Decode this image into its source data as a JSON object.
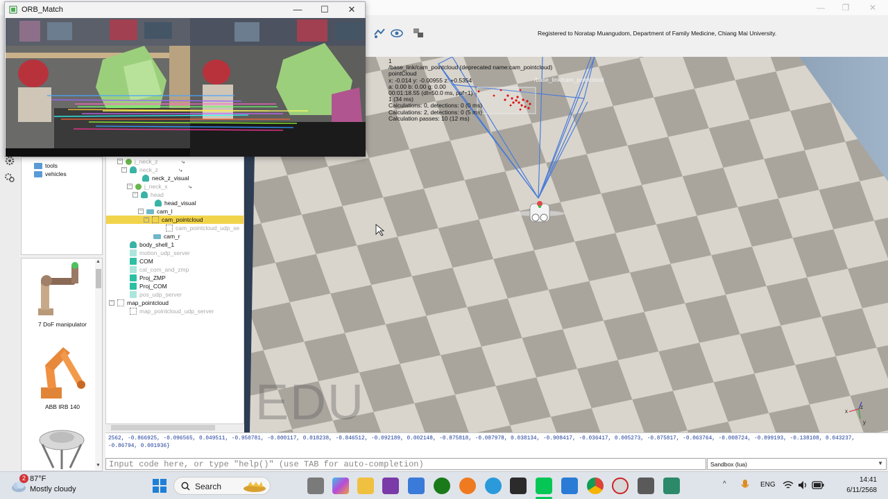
{
  "orb_window": {
    "title": "ORB_Match",
    "minimize": "—",
    "maximize": "☐",
    "close": "✕"
  },
  "app_window": {
    "minimize": "—",
    "maximize": "❐",
    "close": "✕"
  },
  "toolbar": {
    "registered_text": "Registered to Noratap Muangudom, Department of Family Medicine, Chiang Mai University."
  },
  "model_browser": {
    "folders": [
      "tools",
      "vehicles"
    ],
    "models": [
      "7 DoF manipulator",
      "ABB IRB 140"
    ]
  },
  "hierarchy": {
    "rows": [
      {
        "label": "j_neck_z"
      },
      {
        "label": "neck_z"
      },
      {
        "label": "neck_z_visual"
      },
      {
        "label": "j_neck_x"
      },
      {
        "label": "head"
      },
      {
        "label": "head_visual"
      },
      {
        "label": "cam_l"
      },
      {
        "label": "cam_pointcloud"
      },
      {
        "label": "cam_pointcloud_udp_se"
      },
      {
        "label": "cam_r"
      },
      {
        "label": "body_shell_1"
      },
      {
        "label": "motion_udp_server"
      },
      {
        "label": "COM"
      },
      {
        "label": "cal_com_and_zmp"
      },
      {
        "label": "Proj_ZMP"
      },
      {
        "label": "Proj_COM"
      },
      {
        "label": "pos_udp_server"
      },
      {
        "label": "map_pointcloud"
      },
      {
        "label": "map_pointcloud_udp_server"
      }
    ]
  },
  "viewport": {
    "info_lines": [
      "1",
      "/base_link/cam_pointcloud   (deprecated name:cam_pointcloud)",
      "pointCloud",
      "x: -0.014   y: -0.00955   z: +0.5354",
      "a: 0.00    b: 0.00    g: 0.00",
      "00:01:18.55 (dt=50.0 ms, ppf=1)",
      "1 (34 ms)",
      "Calculations: 0, detections: 0 (0 ms)",
      "Calculations: 2, detections: 0 (5 ms)",
      "Calculation passes: 10 (12 ms)"
    ],
    "object_label": "/base_link/cam_pointcloud",
    "watermark": "EDU",
    "axis_x": "x",
    "axis_y": "y",
    "axis_z": "z"
  },
  "console": {
    "output": "2562, -0.866925, -0.096565, 0.049511, -0.950781, -0.000117, 0.018238, -0.846512, -0.092189, 0.002148, -0.875818, -0.087978, 0.038134, -0.908417, -0.036417, 0.005273, -0.875817, -0.063764, -0.008724, -0.899193, -0.138108, 0.043237, -0.86794, 0.001936}",
    "input_placeholder": "Input code here, or type \"help()\" (use TAB for auto-completion)",
    "sandbox_label": "Sandbox (lua)"
  },
  "taskbar": {
    "weather_badge": "2",
    "weather_temp": "87°F",
    "weather_desc": "Mostly cloudy",
    "search_label": "Search",
    "language": "ENG",
    "time": "14:41",
    "date": "6/11/2568",
    "colors": {
      "windows": "#1e7fd8",
      "accent_line": "#06c755"
    }
  }
}
